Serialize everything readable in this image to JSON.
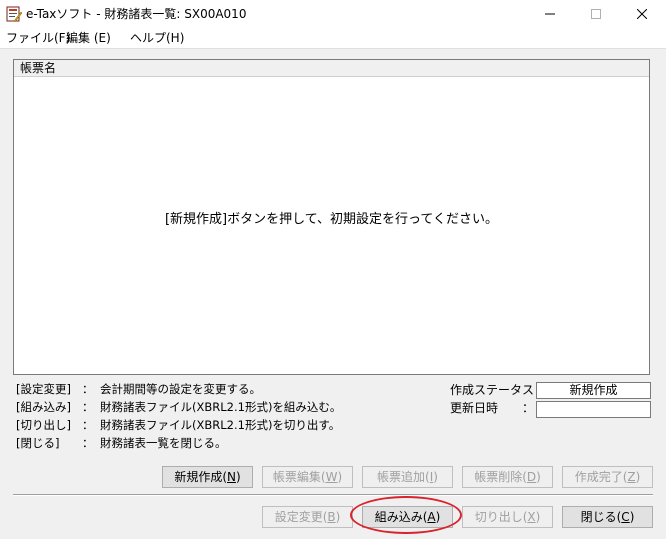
{
  "window": {
    "title": "e-Taxソフト - 財務諸表一覧: SX00A010",
    "controls": {
      "minimize": "—",
      "maximize": "☐",
      "close": "✕"
    }
  },
  "menu": {
    "file": "ファイル(F)",
    "edit": "編集 (E)",
    "help": "ヘルプ(H)"
  },
  "list": {
    "column_header": "帳票名",
    "empty_message": "[新規作成]ボタンを押して、初期設定を行ってください。"
  },
  "help": [
    {
      "key": "[設定変更]",
      "sep": "：",
      "desc": "会計期間等の設定を変更する。"
    },
    {
      "key": "[組み込み]",
      "sep": "：",
      "desc": "財務諸表ファイル(XBRL2.1形式)を組み込む。"
    },
    {
      "key": "[切り出し]",
      "sep": "：",
      "desc": "財務諸表ファイル(XBRL2.1形式)を切り出す。"
    },
    {
      "key": "[閉じる]",
      "sep": "：",
      "desc": "財務諸表一覧を閉じる。"
    }
  ],
  "status": {
    "creation_status_label": "作成ステータス：",
    "creation_status_value": "新規作成",
    "updated_label": "更新日時　　：",
    "updated_value": ""
  },
  "buttons_row1": [
    {
      "label": "新規作成(",
      "key": "N",
      "suffix": ")",
      "enabled": true
    },
    {
      "label": "帳票編集(",
      "key": "W",
      "suffix": ")",
      "enabled": false
    },
    {
      "label": "帳票追加(",
      "key": "I",
      "suffix": ")",
      "enabled": false
    },
    {
      "label": "帳票削除(",
      "key": "D",
      "suffix": ")",
      "enabled": false
    },
    {
      "label": "作成完了(",
      "key": "Z",
      "suffix": ")",
      "enabled": false
    }
  ],
  "buttons_row2": [
    {
      "label": "設定変更(",
      "key": "B",
      "suffix": ")",
      "enabled": false
    },
    {
      "label": "組み込み(",
      "key": "A",
      "suffix": ")",
      "enabled": true
    },
    {
      "label": "切り出し(",
      "key": "X",
      "suffix": ")",
      "enabled": false
    },
    {
      "label": "閉じる(",
      "key": "C",
      "suffix": ")",
      "enabled": true
    }
  ],
  "colors": {
    "highlight": "#d9232d",
    "window_bg": "#f0f0f0"
  }
}
